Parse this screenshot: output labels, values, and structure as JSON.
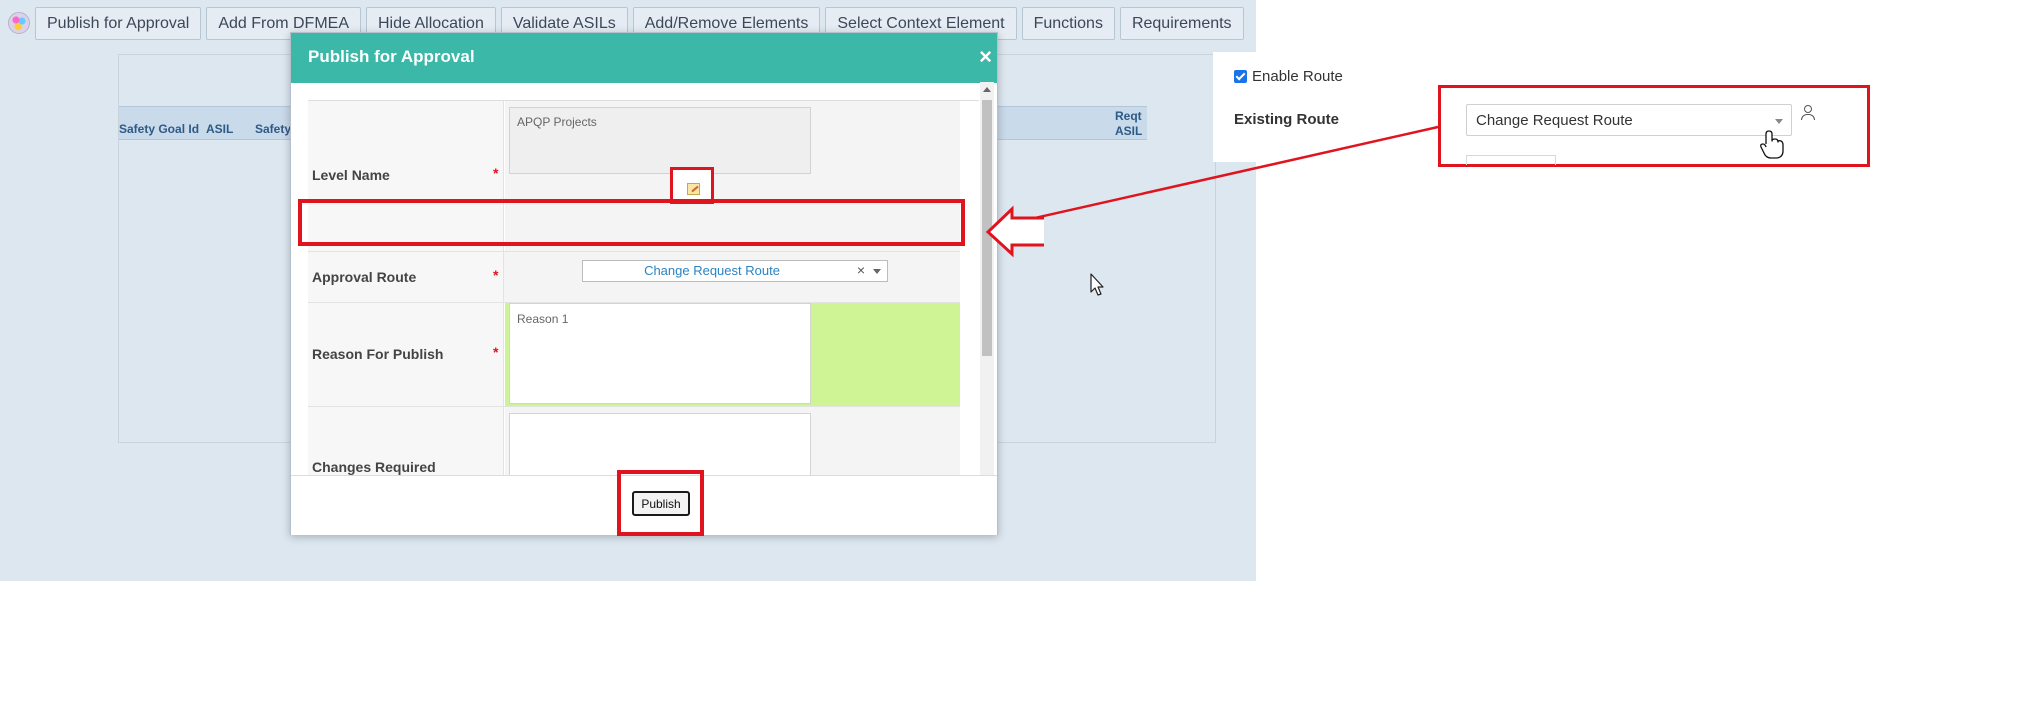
{
  "toolbar": {
    "buttons": [
      "Publish for Approval",
      "Add From DFMEA",
      "Hide Allocation",
      "Validate ASILs",
      "Add/Remove Elements",
      "Select Context Element",
      "Functions",
      "Requirements"
    ]
  },
  "table": {
    "headers": {
      "safety_goal_id": "Safety Goal Id",
      "asil": "ASIL",
      "safety": "Safety",
      "reqt_asil_line1": "Reqt",
      "reqt_asil_line2": "ASIL"
    }
  },
  "route_panel": {
    "enable_route_label": "Enable Route",
    "enable_route_checked": true,
    "existing_route_label": "Existing Route",
    "existing_route_value": "Change Request Route"
  },
  "modal": {
    "title": "Publish for Approval",
    "close_glyph": "×",
    "fields": {
      "level_name_label": "Level Name",
      "level_name_value": "APQP Projects",
      "approval_route_label": "Approval Route",
      "approval_route_value": "Change Request Route",
      "reason_label": "Reason For Publish",
      "reason_value": "Reason 1",
      "changes_label": "Changes Required",
      "required_marker": "*"
    },
    "clear_glyph": "×",
    "publish_label": "Publish"
  },
  "colors": {
    "header_teal": "#3bb8a8",
    "highlight_red": "#e0141e",
    "reason_green": "#cff495",
    "background_blue": "#dde7f0"
  }
}
